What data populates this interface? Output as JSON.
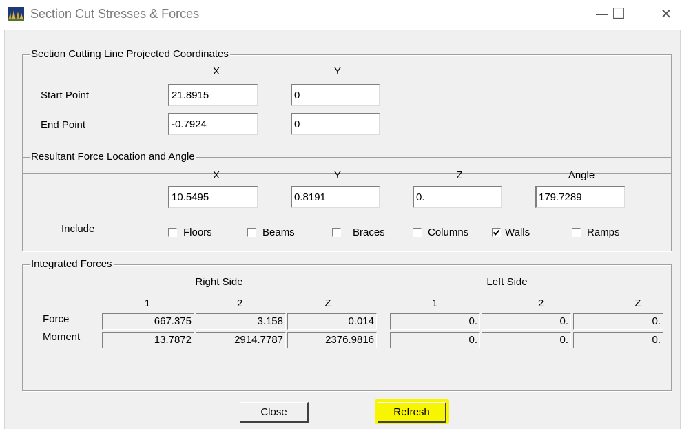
{
  "window": {
    "title": "Section Cut Stresses & Forces",
    "minimize_glyph": "—",
    "maximize_glyph": "☐",
    "close_glyph": "✕"
  },
  "cutting_line": {
    "legend": "Section Cutting Line Projected Coordinates",
    "col_x": "X",
    "col_y": "Y",
    "start_label": "Start Point",
    "start_x": "21.8915",
    "start_y": "0",
    "end_label": "End Point",
    "end_x": "-0.7924",
    "end_y": "0"
  },
  "resultant": {
    "legend": "Resultant Force Location and Angle",
    "col_x": "X",
    "col_y": "Y",
    "col_z": "Z",
    "col_angle": "Angle",
    "x": "10.5495",
    "y": "0.8191",
    "z": "0.",
    "angle": "179.7289",
    "include_label": "Include",
    "checkboxes": [
      {
        "label": "Floors",
        "checked": false
      },
      {
        "label": "Beams",
        "checked": false
      },
      {
        "label": "Braces",
        "checked": false
      },
      {
        "label": "Columns",
        "checked": false
      },
      {
        "label": "Walls",
        "checked": true
      },
      {
        "label": "Ramps",
        "checked": false
      }
    ]
  },
  "integrated": {
    "legend": "Integrated Forces",
    "right_side": "Right Side",
    "left_side": "Left Side",
    "cols": [
      "1",
      "2",
      "Z",
      "1",
      "2",
      "Z"
    ],
    "force_label": "Force",
    "moment_label": "Moment",
    "force": [
      "667.375",
      "3.158",
      "0.014",
      "0.",
      "0.",
      "0."
    ],
    "moment": [
      "13.7872",
      "2914.7787",
      "2376.9816",
      "0.",
      "0.",
      "0."
    ]
  },
  "buttons": {
    "close": "Close",
    "refresh": "Refresh"
  },
  "colors": {
    "highlight": "#f8f500",
    "dialog_bg": "#f0f0f0"
  }
}
